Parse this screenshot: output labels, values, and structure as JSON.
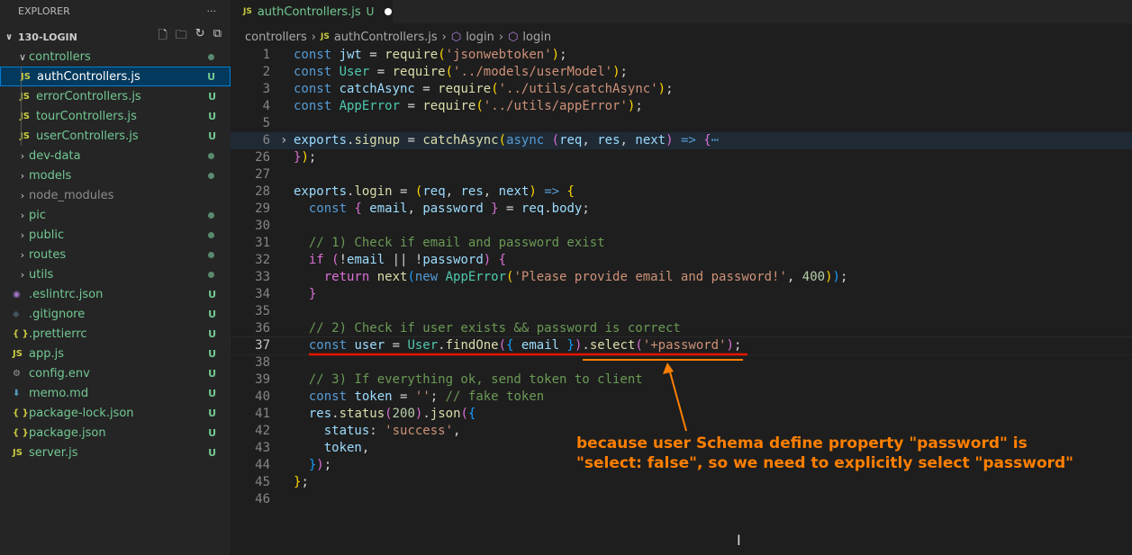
{
  "explorer": {
    "title": "EXPLORER",
    "more": "···",
    "project": "130-LOGIN",
    "items": [
      {
        "label": "controllers",
        "type": "folder-open",
        "status": "dot"
      },
      {
        "label": "authControllers.js",
        "type": "js",
        "status": "U",
        "child": true,
        "selected": true
      },
      {
        "label": "errorControllers.js",
        "type": "js",
        "status": "U",
        "child": true
      },
      {
        "label": "tourControllers.js",
        "type": "js",
        "status": "U",
        "child": true
      },
      {
        "label": "userControllers.js",
        "type": "js",
        "status": "U",
        "child": true
      },
      {
        "label": "dev-data",
        "type": "folder",
        "status": "dot"
      },
      {
        "label": "models",
        "type": "folder",
        "status": "dot"
      },
      {
        "label": "node_modules",
        "type": "folder",
        "status": "",
        "ignored": true
      },
      {
        "label": "pic",
        "type": "folder",
        "status": "dot"
      },
      {
        "label": "public",
        "type": "folder",
        "status": "dot"
      },
      {
        "label": "routes",
        "type": "folder",
        "status": "dot"
      },
      {
        "label": "utils",
        "type": "folder",
        "status": "dot"
      },
      {
        "label": ".eslintrc.json",
        "type": "eslint",
        "status": "U"
      },
      {
        "label": ".gitignore",
        "type": "git",
        "status": "U"
      },
      {
        "label": ".prettierrc",
        "type": "json",
        "status": "U"
      },
      {
        "label": "app.js",
        "type": "js",
        "status": "U"
      },
      {
        "label": "config.env",
        "type": "gear",
        "status": "U"
      },
      {
        "label": "memo.md",
        "type": "md",
        "status": "U"
      },
      {
        "label": "package-lock.json",
        "type": "json",
        "status": "U"
      },
      {
        "label": "package.json",
        "type": "json",
        "status": "U"
      },
      {
        "label": "server.js",
        "type": "js",
        "status": "U"
      }
    ]
  },
  "tab": {
    "icon": "JS",
    "label": "authControllers.js",
    "status": "U"
  },
  "breadcrumb": [
    "controllers",
    "authControllers.js",
    "login",
    "login"
  ],
  "code": [
    {
      "n": "1",
      "t": [
        [
          "const ",
          "kw"
        ],
        [
          "jwt",
          "var"
        ],
        [
          " = ",
          "p"
        ],
        [
          "require",
          "fn"
        ],
        [
          "(",
          "b1"
        ],
        [
          "'jsonwebtoken'",
          "str"
        ],
        [
          ")",
          "b1"
        ],
        [
          ";",
          "p"
        ]
      ]
    },
    {
      "n": "2",
      "t": [
        [
          "const ",
          "kw"
        ],
        [
          "User",
          "cls"
        ],
        [
          " = ",
          "p"
        ],
        [
          "require",
          "fn"
        ],
        [
          "(",
          "b1"
        ],
        [
          "'../models/userModel'",
          "str"
        ],
        [
          ")",
          "b1"
        ],
        [
          ";",
          "p"
        ]
      ]
    },
    {
      "n": "3",
      "t": [
        [
          "const ",
          "kw"
        ],
        [
          "catchAsync",
          "var"
        ],
        [
          " = ",
          "p"
        ],
        [
          "require",
          "fn"
        ],
        [
          "(",
          "b1"
        ],
        [
          "'../utils/catchAsync'",
          "str"
        ],
        [
          ")",
          "b1"
        ],
        [
          ";",
          "p"
        ]
      ]
    },
    {
      "n": "4",
      "t": [
        [
          "const ",
          "kw"
        ],
        [
          "AppError",
          "cls"
        ],
        [
          " = ",
          "p"
        ],
        [
          "require",
          "fn"
        ],
        [
          "(",
          "b1"
        ],
        [
          "'../utils/appError'",
          "str"
        ],
        [
          ")",
          "b1"
        ],
        [
          ";",
          "p"
        ]
      ]
    },
    {
      "n": "5",
      "t": []
    },
    {
      "n": "6",
      "fold": true,
      "t": [
        [
          "exports",
          "var"
        ],
        [
          ".",
          "p"
        ],
        [
          "signup",
          "fn"
        ],
        [
          " = ",
          "p"
        ],
        [
          "catchAsync",
          "fn"
        ],
        [
          "(",
          "b1"
        ],
        [
          "async ",
          "kw"
        ],
        [
          "(",
          "b2"
        ],
        [
          "req",
          "var"
        ],
        [
          ", ",
          "p"
        ],
        [
          "res",
          "var"
        ],
        [
          ", ",
          "p"
        ],
        [
          "next",
          "var"
        ],
        [
          ")",
          "b2"
        ],
        [
          " => ",
          "kw"
        ],
        [
          "{",
          "b2"
        ],
        [
          "⋯",
          "ell"
        ]
      ]
    },
    {
      "n": "26",
      "t": [
        [
          "}",
          "b2"
        ],
        [
          ")",
          "b1"
        ],
        [
          ";",
          "p"
        ]
      ]
    },
    {
      "n": "27",
      "t": []
    },
    {
      "n": "28",
      "t": [
        [
          "exports",
          "var"
        ],
        [
          ".",
          "p"
        ],
        [
          "login",
          "fn"
        ],
        [
          " = ",
          "p"
        ],
        [
          "(",
          "b1"
        ],
        [
          "req",
          "var"
        ],
        [
          ", ",
          "p"
        ],
        [
          "res",
          "var"
        ],
        [
          ", ",
          "p"
        ],
        [
          "next",
          "var"
        ],
        [
          ")",
          "b1"
        ],
        [
          " => ",
          "kw"
        ],
        [
          "{",
          "b1"
        ]
      ]
    },
    {
      "n": "29",
      "t": [
        [
          "  const ",
          "kw"
        ],
        [
          "{ ",
          "b2"
        ],
        [
          "email",
          "var"
        ],
        [
          ", ",
          "p"
        ],
        [
          "password",
          "var"
        ],
        [
          " }",
          "b2"
        ],
        [
          " = ",
          "p"
        ],
        [
          "req",
          "var"
        ],
        [
          ".",
          "p"
        ],
        [
          "body",
          "var"
        ],
        [
          ";",
          "p"
        ]
      ]
    },
    {
      "n": "30",
      "t": []
    },
    {
      "n": "31",
      "t": [
        [
          "  // 1) Check if email and password exist",
          "cm"
        ]
      ]
    },
    {
      "n": "32",
      "t": [
        [
          "  if ",
          "b2"
        ],
        [
          "(",
          "b2"
        ],
        [
          "!",
          "p"
        ],
        [
          "email",
          "var"
        ],
        [
          " || ",
          "p"
        ],
        [
          "!",
          "p"
        ],
        [
          "password",
          "var"
        ],
        [
          ") ",
          "b2"
        ],
        [
          "{",
          "b2"
        ]
      ]
    },
    {
      "n": "33",
      "t": [
        [
          "    return ",
          "b2"
        ],
        [
          "next",
          "fn"
        ],
        [
          "(",
          "b3"
        ],
        [
          "new ",
          "kw"
        ],
        [
          "AppError",
          "cls"
        ],
        [
          "(",
          "b1"
        ],
        [
          "'Please provide email and password!'",
          "str"
        ],
        [
          ", ",
          "p"
        ],
        [
          "400",
          "nm"
        ],
        [
          ")",
          "b1"
        ],
        [
          ")",
          "b3"
        ],
        [
          ";",
          "p"
        ]
      ]
    },
    {
      "n": "34",
      "t": [
        [
          "  }",
          "b2"
        ]
      ]
    },
    {
      "n": "35",
      "t": []
    },
    {
      "n": "36",
      "t": [
        [
          "  // 2) Check if user exists && password is correct",
          "cm"
        ]
      ]
    },
    {
      "n": "37",
      "cur": true,
      "t": [
        [
          "  const ",
          "kw"
        ],
        [
          "user",
          "var"
        ],
        [
          " = ",
          "p"
        ],
        [
          "User",
          "cls"
        ],
        [
          ".",
          "p"
        ],
        [
          "findOne",
          "fn"
        ],
        [
          "(",
          "b2"
        ],
        [
          "{ ",
          "b3"
        ],
        [
          "email",
          "var"
        ],
        [
          " }",
          "b3"
        ],
        [
          ")",
          "b2"
        ],
        [
          ".",
          "p"
        ],
        [
          "select",
          "fn"
        ],
        [
          "(",
          "b2"
        ],
        [
          "'+password'",
          "str"
        ],
        [
          ")",
          "b2"
        ],
        [
          ";",
          "p"
        ]
      ]
    },
    {
      "n": "38",
      "t": []
    },
    {
      "n": "39",
      "t": [
        [
          "  // 3) If everything ok, send token to client",
          "cm"
        ]
      ]
    },
    {
      "n": "40",
      "t": [
        [
          "  const ",
          "kw"
        ],
        [
          "token",
          "var"
        ],
        [
          " = ",
          "p"
        ],
        [
          "''",
          "str"
        ],
        [
          "; ",
          "p"
        ],
        [
          "// fake token",
          "cm"
        ]
      ]
    },
    {
      "n": "41",
      "t": [
        [
          "  res",
          "var"
        ],
        [
          ".",
          "p"
        ],
        [
          "status",
          "fn"
        ],
        [
          "(",
          "b2"
        ],
        [
          "200",
          "nm"
        ],
        [
          ")",
          "b2"
        ],
        [
          ".",
          "p"
        ],
        [
          "json",
          "fn"
        ],
        [
          "(",
          "b2"
        ],
        [
          "{",
          "b3"
        ]
      ]
    },
    {
      "n": "42",
      "t": [
        [
          "    status",
          "var"
        ],
        [
          ": ",
          "p"
        ],
        [
          "'success'",
          "str"
        ],
        [
          ",",
          "p"
        ]
      ]
    },
    {
      "n": "43",
      "t": [
        [
          "    token",
          "var"
        ],
        [
          ",",
          "p"
        ]
      ]
    },
    {
      "n": "44",
      "t": [
        [
          "  }",
          "b3"
        ],
        [
          ")",
          "b2"
        ],
        [
          ";",
          "p"
        ]
      ]
    },
    {
      "n": "45",
      "t": [
        [
          "}",
          "b1"
        ],
        [
          ";",
          "p"
        ]
      ]
    },
    {
      "n": "46",
      "t": []
    }
  ],
  "annotation": {
    "line1": "because user Schema define property \"password\" is",
    "line2": "\"select: false\", so we need to explicitly select \"password\"",
    "color": "#ff7f00",
    "underline_color": "#e51400"
  }
}
